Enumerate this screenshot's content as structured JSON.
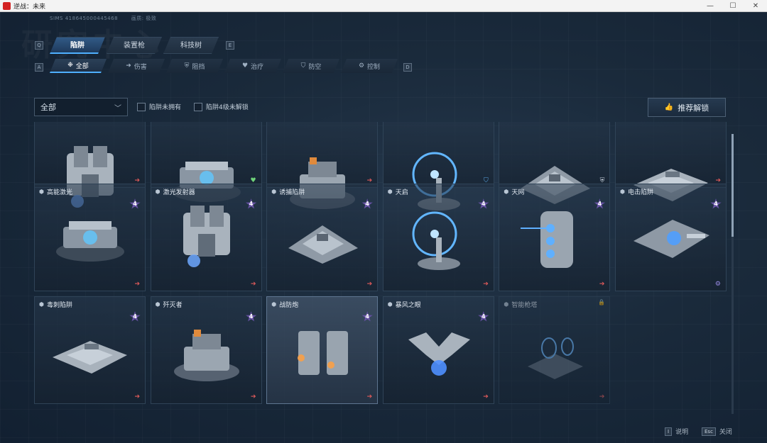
{
  "window": {
    "title": "逆战：未来",
    "controls": [
      "—",
      "☐",
      "✕"
    ]
  },
  "header": {
    "sims": "SIMS 418645000445468",
    "sims_right": "画质: 极致",
    "watermark": "研究中心"
  },
  "main_tabs": {
    "left_key": "Q",
    "right_key": "E",
    "items": [
      {
        "label": "陷阱",
        "active": true
      },
      {
        "label": "装置枪",
        "active": false
      },
      {
        "label": "科技树",
        "active": false
      }
    ]
  },
  "sub_tabs": {
    "left_key": "A",
    "right_key": "D",
    "items": [
      {
        "icon": "grid-icon",
        "glyph": "❉",
        "label": "全部",
        "active": true
      },
      {
        "icon": "damage-icon",
        "glyph": "➜",
        "label": "伤害",
        "active": false
      },
      {
        "icon": "block-icon",
        "glyph": "⛨",
        "label": "阻挡",
        "active": false
      },
      {
        "icon": "heal-icon",
        "glyph": "♥",
        "label": "治疗",
        "active": false
      },
      {
        "icon": "antiair-icon",
        "glyph": "⛉",
        "label": "防空",
        "active": false
      },
      {
        "icon": "control-icon",
        "glyph": "⚙",
        "label": "控制",
        "active": false
      }
    ]
  },
  "filters": {
    "dropdown_value": "全部",
    "dropdown_chevron": "﹀",
    "checkbox_1": "陷阱未拥有",
    "checkbox_2": "陷阱4级未解锁",
    "recommend_button": "推荐解锁",
    "recommend_icon": "👍"
  },
  "cards_row0": [
    {
      "name": "",
      "status": "arrow"
    },
    {
      "name": "",
      "status": "heal"
    },
    {
      "name": "",
      "status": "arrow"
    },
    {
      "name": "",
      "status": "antiair"
    },
    {
      "name": "",
      "status": "block"
    },
    {
      "name": "",
      "status": "arrow"
    }
  ],
  "cards": [
    {
      "name": "高能激光",
      "level": "4",
      "status": "arrow"
    },
    {
      "name": "激光发射器",
      "level": "4",
      "status": "arrow"
    },
    {
      "name": "诱捕陷阱",
      "level": "4",
      "status": "arrow"
    },
    {
      "name": "天启",
      "level": "4",
      "status": "arrow"
    },
    {
      "name": "天网",
      "level": "4",
      "status": "arrow"
    },
    {
      "name": "电击陷阱",
      "level": "4",
      "status": "control"
    },
    {
      "name": "毒刺陷阱",
      "level": "4",
      "status": "arrow"
    },
    {
      "name": "歼灭者",
      "level": "4",
      "status": "arrow"
    },
    {
      "name": "战防炮",
      "level": "4",
      "status": "arrow",
      "highlight": true
    },
    {
      "name": "暴风之眼",
      "level": "4",
      "status": "arrow"
    },
    {
      "name": "智能枪塔",
      "level": "",
      "status": "arrow",
      "locked": true
    }
  ],
  "icons": {
    "arrow": "➔",
    "heal": "♥",
    "antiair": "⛉",
    "block": "⛨",
    "control": "⚙",
    "cube": "⬢",
    "lock": "🔒"
  },
  "footer": {
    "help_key": "I",
    "help_label": "说明",
    "close_key": "Esc",
    "close_label": "关闭"
  },
  "colors": {
    "accent": "#4fb0ff",
    "arrow": "#e05a5a",
    "heal": "#6fd37a",
    "level_badge": "#6a55a8"
  }
}
